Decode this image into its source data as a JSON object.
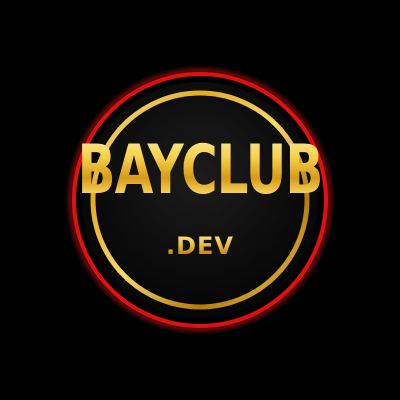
{
  "logo": {
    "name": "BAYCLUB",
    "suffix": ".DEV"
  },
  "colors": {
    "background": "#000000",
    "outer_ring": "#e01010",
    "gold": "#e9b934",
    "badge_fill": "#0d0d0d"
  }
}
